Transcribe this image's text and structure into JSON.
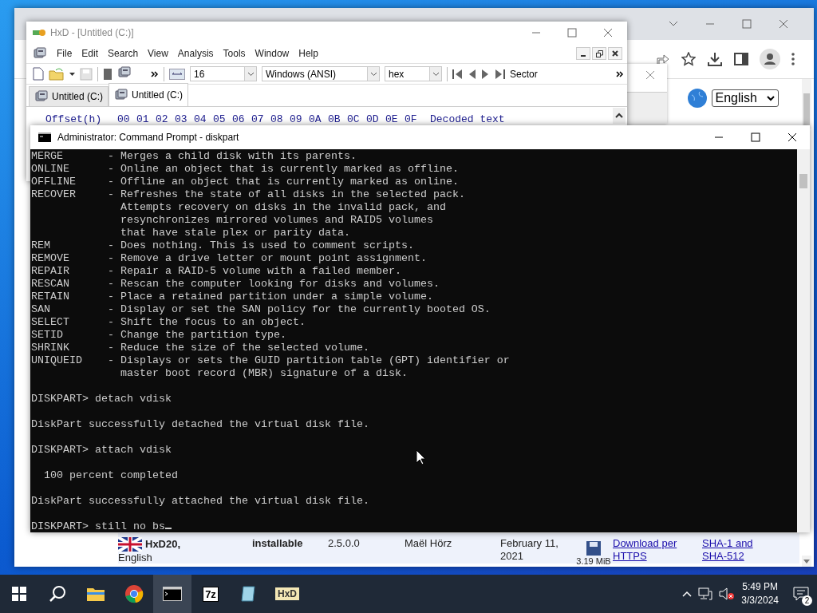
{
  "browser": {
    "language_select": "English",
    "row": {
      "name": "HxD20,",
      "subname": "English",
      "type": "installable",
      "version": "2.5.0.0",
      "author": "Maël Hörz",
      "date": "February 11, 2021",
      "size": "3.19 MiB",
      "download_link": "Download per HTTPS",
      "hash_link": "SHA-1 and SHA-512"
    }
  },
  "hxd": {
    "title": "HxD - [Untitled (C:)]",
    "active": false,
    "menu": [
      "File",
      "Edit",
      "Search",
      "View",
      "Analysis",
      "Tools",
      "Window",
      "Help"
    ],
    "toolbar": [
      {
        "kind": "new",
        "disabled": false
      },
      {
        "kind": "open",
        "disabled": false
      },
      {
        "kind": "save",
        "disabled": true
      },
      {
        "kind": "chip",
        "disabled": false
      },
      {
        "kind": "disk",
        "disabled": false
      }
    ],
    "bytes_per_row": "16",
    "charset": "Windows (ANSI)",
    "format": "hex",
    "nav_label": "Sector",
    "tabs": [
      {
        "label": "Untitled (C:)",
        "selected": false
      },
      {
        "label": "Untitled (C:)",
        "selected": true
      }
    ],
    "header": {
      "offset_label": "Offset(h)",
      "columns": [
        "00",
        "01",
        "02",
        "03",
        "04",
        "05",
        "06",
        "07",
        "08",
        "09",
        "0A",
        "0B",
        "0C",
        "0D",
        "0E",
        "0F"
      ],
      "decoded_label": "Decoded text"
    }
  },
  "cmd": {
    "title": "Administrator: Command Prompt - diskpart",
    "active": true,
    "paragraphs": [
      [
        "MERGE       - Merges a child disk with its parents.",
        "ONLINE      - Online an object that is currently marked as offline.",
        "OFFLINE     - Offline an object that is currently marked as online.",
        "RECOVER     - Refreshes the state of all disks in the selected pack.",
        "              Attempts recovery on disks in the invalid pack, and",
        "              resynchronizes mirrored volumes and RAID5 volumes",
        "              that have stale plex or parity data.",
        "REM         - Does nothing. This is used to comment scripts.",
        "REMOVE      - Remove a drive letter or mount point assignment.",
        "REPAIR      - Repair a RAID-5 volume with a failed member.",
        "RESCAN      - Rescan the computer looking for disks and volumes.",
        "RETAIN      - Place a retained partition under a simple volume.",
        "SAN         - Display or set the SAN policy for the currently booted OS.",
        "SELECT      - Shift the focus to an object.",
        "SETID       - Change the partition type.",
        "SHRINK      - Reduce the size of the selected volume.",
        "UNIQUEID    - Displays or sets the GUID partition table (GPT) identifier or",
        "              master boot record (MBR) signature of a disk."
      ],
      [
        "DISKPART> detach vdisk"
      ],
      [
        "DiskPart successfully detached the virtual disk file."
      ],
      [
        "DISKPART> attach vdisk"
      ],
      [
        "  100 percent completed"
      ],
      [
        "DiskPart successfully attached the virtual disk file."
      ],
      [
        "DISKPART> still no bs"
      ]
    ]
  },
  "taskbar": {
    "apps": [
      {
        "kind": "explorer",
        "selected": false
      },
      {
        "kind": "chrome",
        "selected": false
      },
      {
        "kind": "terminal",
        "selected": true
      },
      {
        "kind": "archive",
        "label": "7z",
        "selected": false
      },
      {
        "kind": "notes",
        "selected": false
      },
      {
        "kind": "hxd",
        "label": "HxD",
        "selected": false
      }
    ],
    "time": "5:49 PM",
    "date": "3/3/2024",
    "notifications": "2"
  }
}
